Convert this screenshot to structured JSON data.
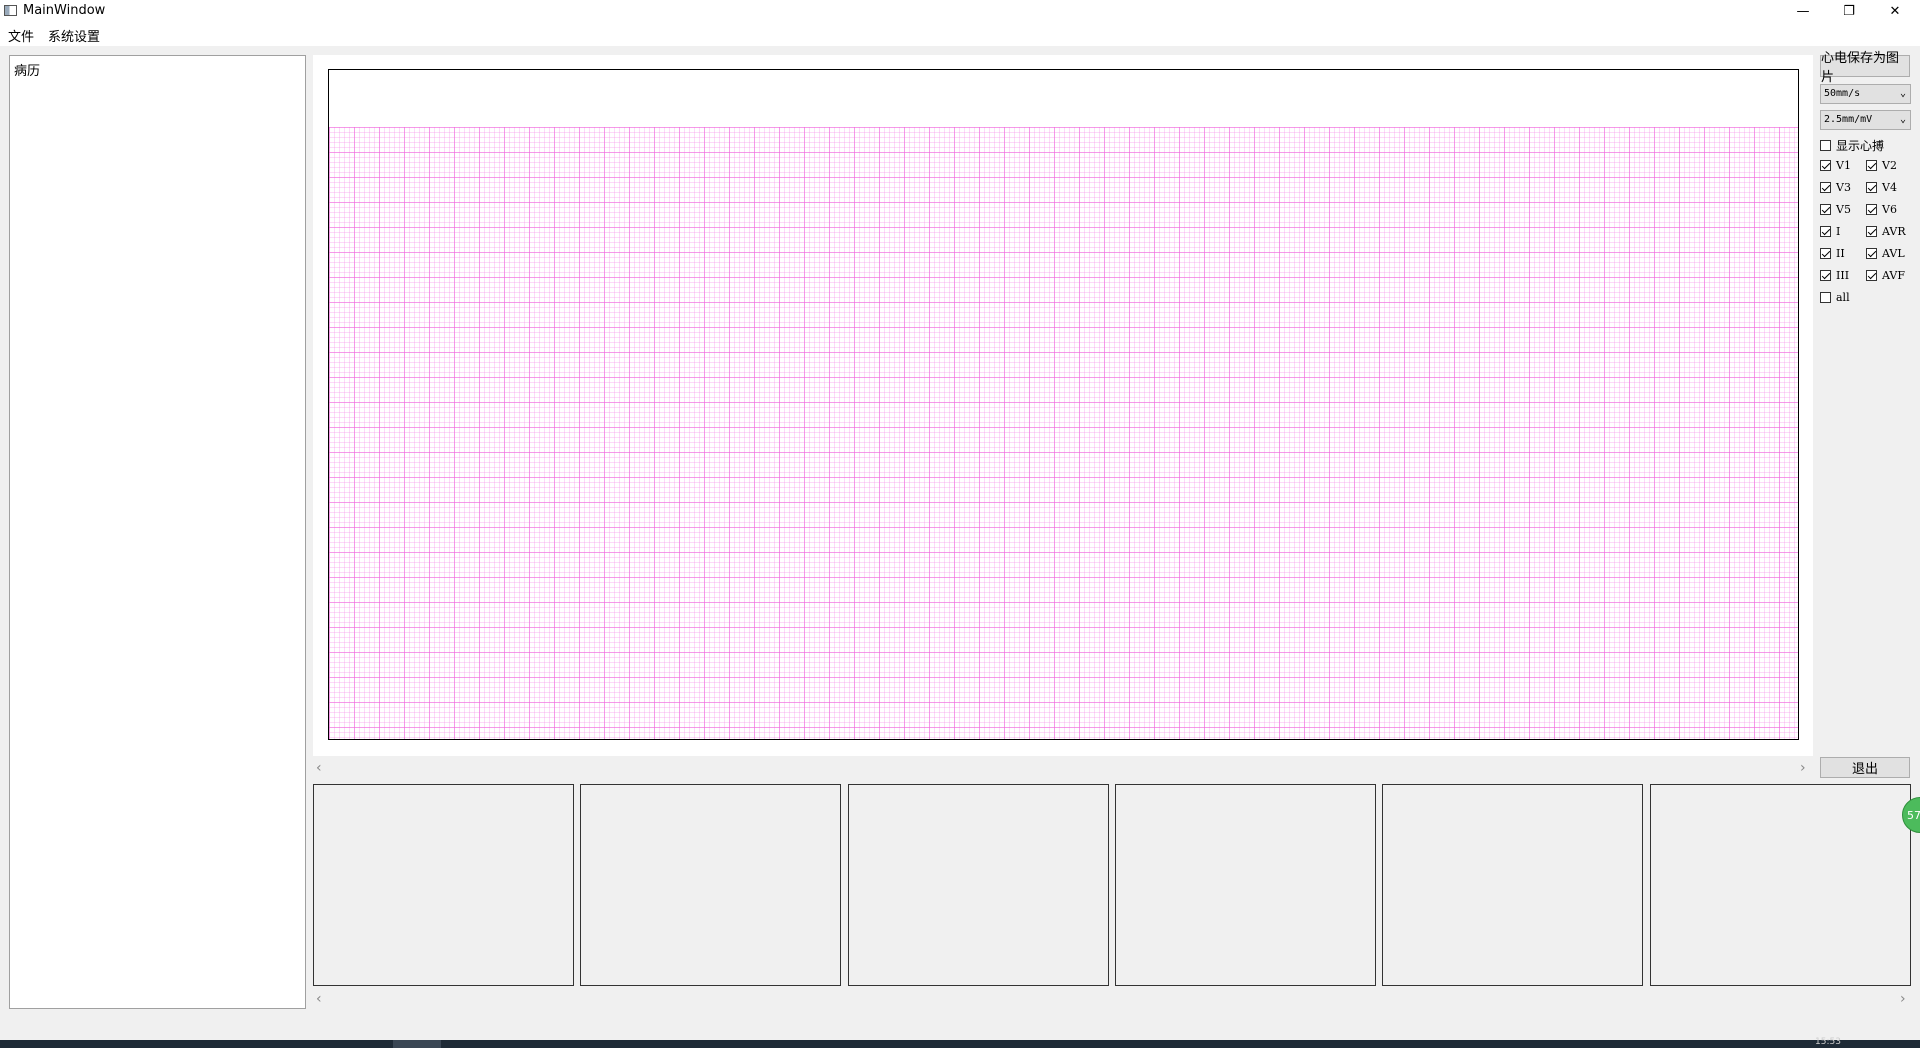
{
  "window": {
    "title": "MainWindow",
    "minimize_glyph": "—",
    "restore_glyph": "❐",
    "close_glyph": "✕"
  },
  "menu": [
    {
      "label": "文件"
    },
    {
      "label": "系统设置"
    }
  ],
  "left_panel": {
    "label": "病历"
  },
  "controls": {
    "save_image_label": "心电保存为图片",
    "speed": {
      "value": "50mm/s"
    },
    "gain": {
      "value": "2.5mm/mV"
    },
    "show_beat": {
      "label": "显示心搏",
      "checked": false
    },
    "leads": [
      {
        "label": "V1",
        "checked": true
      },
      {
        "label": "V2",
        "checked": true
      },
      {
        "label": "V3",
        "checked": true
      },
      {
        "label": "V4",
        "checked": true
      },
      {
        "label": "V5",
        "checked": true
      },
      {
        "label": "V6",
        "checked": true
      },
      {
        "label": "I",
        "checked": true
      },
      {
        "label": "AVR",
        "checked": true
      },
      {
        "label": "II",
        "checked": true
      },
      {
        "label": "AVL",
        "checked": true
      },
      {
        "label": "III",
        "checked": true
      },
      {
        "label": "AVF",
        "checked": true
      }
    ],
    "all": {
      "label": "all",
      "checked": false
    },
    "exit_label": "退出"
  },
  "colors": {
    "grid_major": "#f064dc",
    "grid_minor": "#f596eb",
    "badge": "#4cbb5c"
  },
  "badge": {
    "text": "57"
  },
  "scroll": {
    "left_arrow": "‹",
    "right_arrow": "›"
  },
  "taskbar": {
    "clock": "15:53"
  }
}
